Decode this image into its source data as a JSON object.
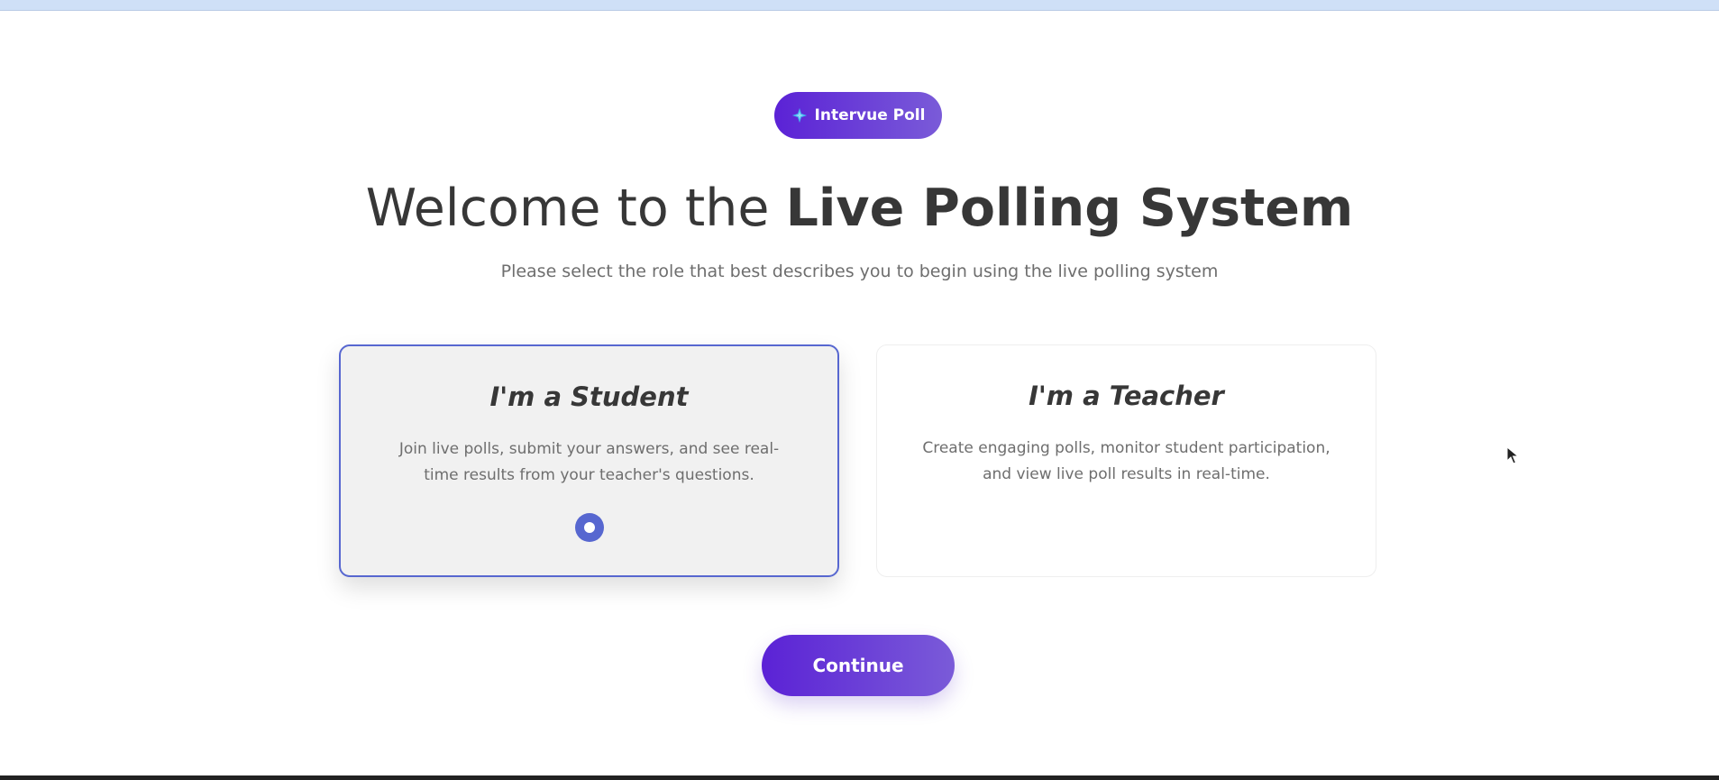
{
  "brand": {
    "label": "Intervue Poll",
    "icon": "sparkle-icon",
    "color_start": "#5b22d6",
    "color_end": "#7a5bd8"
  },
  "header": {
    "title_regular": "Welcome to the ",
    "title_bold": "Live Polling System",
    "subtitle": "Please select the role that best describes you to begin using the live polling system"
  },
  "roles": [
    {
      "title": "I'm a Student",
      "description": "Join live polls, submit your answers, and see real-time results from your teacher's questions.",
      "selected": true
    },
    {
      "title": "I'm a Teacher",
      "description": "Create engaging polls, monitor student participation, and view live poll results in real-time.",
      "selected": false
    }
  ],
  "actions": {
    "continue_label": "Continue"
  },
  "colors": {
    "accent": "#5767d0",
    "selected_card_bg": "#f1f1f1"
  }
}
